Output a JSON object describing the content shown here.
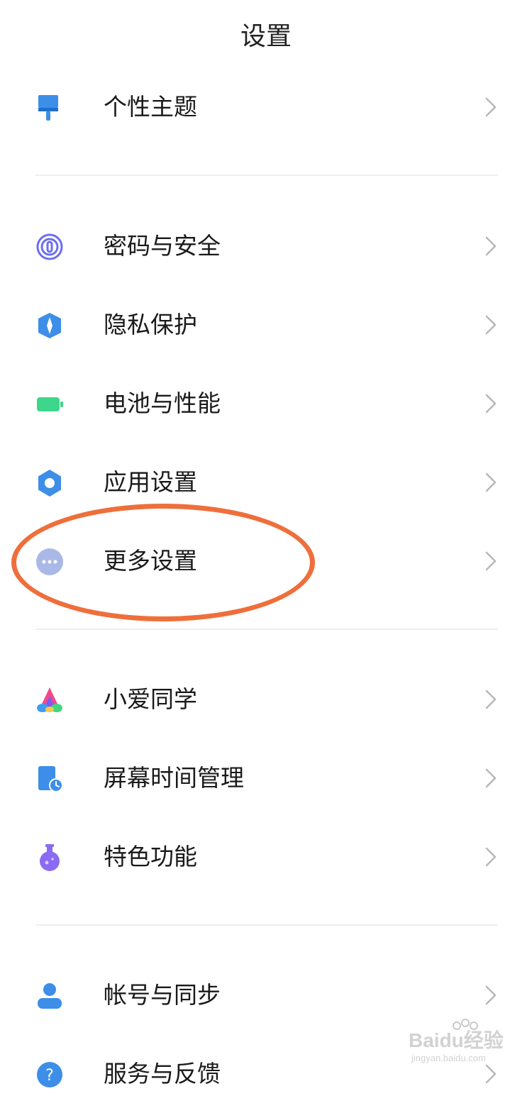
{
  "header": {
    "title": "设置"
  },
  "groups": [
    {
      "items": [
        {
          "label": "个性主题",
          "icon": "paint-brush-icon"
        }
      ]
    },
    {
      "items": [
        {
          "label": "密码与安全",
          "icon": "fingerprint-icon"
        },
        {
          "label": "隐私保护",
          "icon": "privacy-shield-icon"
        },
        {
          "label": "电池与性能",
          "icon": "battery-icon"
        },
        {
          "label": "应用设置",
          "icon": "gear-icon"
        },
        {
          "label": "更多设置",
          "icon": "more-dots-icon"
        }
      ]
    },
    {
      "items": [
        {
          "label": "小爱同学",
          "icon": "xiaoai-assistant-icon"
        },
        {
          "label": "屏幕时间管理",
          "icon": "screen-time-icon"
        },
        {
          "label": "特色功能",
          "icon": "flask-icon"
        }
      ]
    },
    {
      "items": [
        {
          "label": "帐号与同步",
          "icon": "account-icon"
        },
        {
          "label": "服务与反馈",
          "icon": "help-icon"
        }
      ]
    }
  ],
  "annotation": {
    "highlighted_item": "更多设置",
    "color": "#ee6f3b"
  },
  "watermark": {
    "brand": "Baidu经验",
    "url": "jingyan.baidu.com"
  },
  "colors": {
    "accent_blue": "#3d8ee8",
    "fingerprint_purple": "#6b6ef0",
    "battery_green": "#3ed68a",
    "more_dots_lavender": "#aab8e8",
    "flask_purple": "#8a6cf2"
  }
}
